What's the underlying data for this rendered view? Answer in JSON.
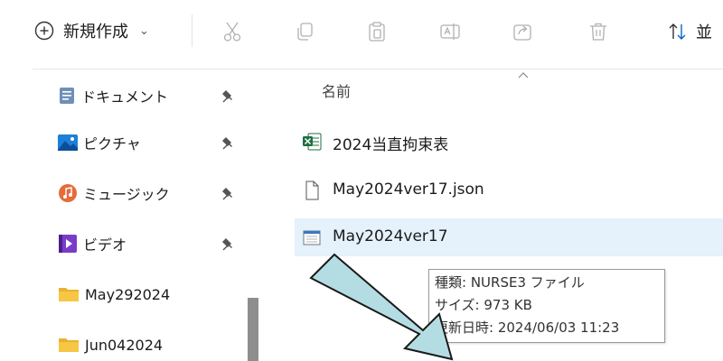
{
  "toolbar": {
    "new_label": "新規作成",
    "new_chevron": "⌄",
    "sort_label": "並"
  },
  "sidebar": {
    "items": [
      {
        "label": "ドキュメント",
        "pinned": true
      },
      {
        "label": "ピクチャ",
        "pinned": true
      },
      {
        "label": "ミュージック",
        "pinned": true
      },
      {
        "label": "ビデオ",
        "pinned": true
      },
      {
        "label": "May292024",
        "pinned": false
      },
      {
        "label": "Jun042024",
        "pinned": false
      }
    ]
  },
  "content": {
    "column_name": "名前",
    "files": [
      {
        "name": "2024当直拘束表",
        "type": "excel"
      },
      {
        "name": "May2024ver17.json",
        "type": "file"
      },
      {
        "name": "May2024ver17",
        "type": "nurse3",
        "selected": true
      }
    ]
  },
  "tooltip": {
    "type_line": "種類: NURSE3 ファイル",
    "size_line": "サイズ: 973 KB",
    "date_line": "更新日時: 2024/06/03 11:23"
  },
  "colors": {
    "selection": "#e5f1fb",
    "arrow_fill": "#b4dde3",
    "folder": "#f6c644"
  }
}
